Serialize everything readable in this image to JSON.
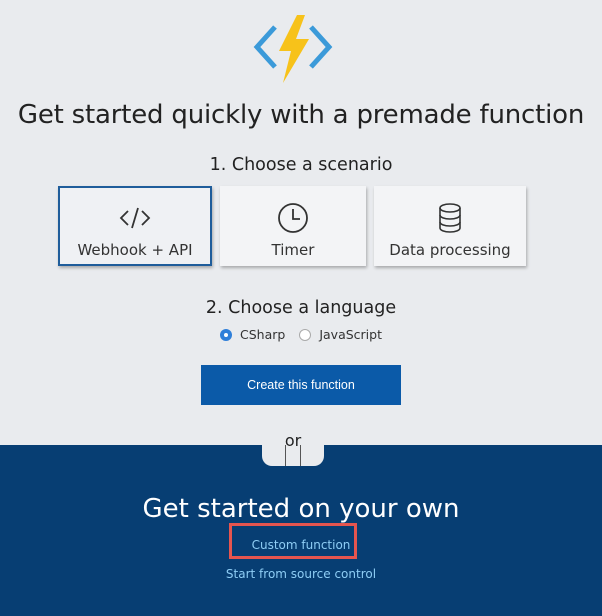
{
  "colors": {
    "accent": "#0b5aa8",
    "dark_band": "#073e73",
    "highlight": "#e5554f",
    "link": "#8ecdf5",
    "logo_bolt": "#f7c21a",
    "logo_brackets": "#3b9ad9"
  },
  "header": {
    "logo_icon": "azure-functions-bolt-icon",
    "title": "Get started quickly with a premade function"
  },
  "scenario": {
    "label": "1. Choose a scenario",
    "cards": [
      {
        "icon": "code-brackets-icon",
        "label": "Webhook + API",
        "selected": true
      },
      {
        "icon": "clock-icon",
        "label": "Timer",
        "selected": false
      },
      {
        "icon": "database-icon",
        "label": "Data processing",
        "selected": false
      }
    ]
  },
  "language": {
    "label": "2. Choose a language",
    "options": [
      {
        "label": "CSharp",
        "selected": true
      },
      {
        "label": "JavaScript",
        "selected": false
      }
    ]
  },
  "create_button": "Create this function",
  "separator": "or",
  "own": {
    "title": "Get started on your own",
    "custom_link": "Custom function",
    "source_link": "Start from source control"
  }
}
